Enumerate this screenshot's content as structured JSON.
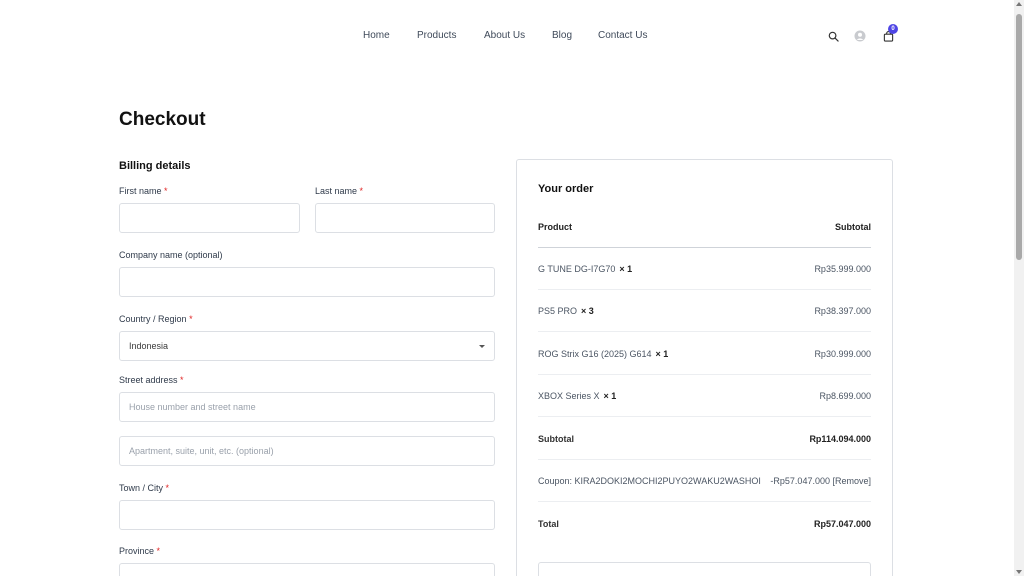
{
  "nav": {
    "items": [
      "Home",
      "Products",
      "About Us",
      "Blog",
      "Contact Us"
    ],
    "cart_count": "0"
  },
  "page": {
    "title": "Checkout"
  },
  "billing": {
    "title": "Billing details",
    "first_name_label": "First name",
    "last_name_label": "Last name",
    "company_label": "Company name (optional)",
    "country_label": "Country / Region",
    "country_value": "Indonesia",
    "street_label": "Street address",
    "street_placeholder": "House number and street name",
    "apartment_placeholder": "Apartment, suite, unit, etc. (optional)",
    "city_label": "Town / City",
    "province_label": "Province",
    "required_mark": "*"
  },
  "order": {
    "title": "Your order",
    "head_product": "Product",
    "head_subtotal": "Subtotal",
    "items": [
      {
        "name": "G TUNE DG-I7G70",
        "qty": "× 1",
        "price": "Rp35.999.000"
      },
      {
        "name": "PS5 PRO",
        "qty": "× 3",
        "price": "Rp38.397.000"
      },
      {
        "name": "ROG Strix G16 (2025) G614",
        "qty": "× 1",
        "price": "Rp30.999.000"
      },
      {
        "name": "XBOX Series X",
        "qty": "× 1",
        "price": "Rp8.699.000"
      }
    ],
    "subtotal_label": "Subtotal",
    "subtotal_value": "Rp114.094.000",
    "coupon_label": "Coupon: KIRA2DOKI2MOCHI2PUYO2WAKU2WASHOI",
    "coupon_value": "-Rp57.047.000",
    "coupon_remove": "[Remove]",
    "total_label": "Total",
    "total_value": "Rp57.047.000"
  },
  "colors": {
    "accent": "#4f46e5",
    "required": "#e02424"
  },
  "icons": [
    "search-icon",
    "user-icon",
    "cart-icon"
  ]
}
